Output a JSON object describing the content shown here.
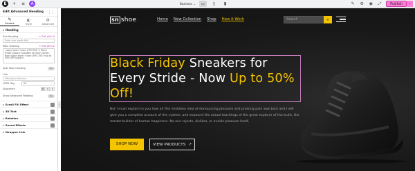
{
  "topbar": {
    "logo_glyph": "E",
    "add_icon": "+",
    "structure_icon": "≡",
    "ai_icon": "A",
    "site_select": "Business",
    "devices": [
      "desktop-icon",
      "tablet-icon",
      "mobile-icon"
    ],
    "right_icons": [
      "ai-magic-icon",
      "settings-icon",
      "preview-icon",
      "history-icon"
    ],
    "publish_label": "Publish",
    "publish_dropdown": "⌄"
  },
  "sidebar": {
    "title": "Edit Advanced Heading",
    "tabs": [
      {
        "icon": "✎",
        "label": "Content",
        "active": true
      },
      {
        "icon": "◐",
        "label": "Style",
        "active": false
      },
      {
        "icon": "⚙",
        "label": "Advanced",
        "active": false
      }
    ],
    "heading_section": "Heading",
    "sub_heading_label": "Sub Heading",
    "sub_heading_ai": "✦ Edit with AI",
    "sub_heading_placeholder": "Enter your prefix title",
    "main_heading_label": "Main Heading",
    "main_heading_ai": "✦ Edit with AI",
    "main_heading_value": "<span style=\"color: #FFC700;\"> Black Friday</span> Sneakers for Every Stride - Now <span style=\"color: #FFC700;\">Up to 50% Off!</span>",
    "split_label": "Split Main Heading",
    "split_toggle": "No",
    "link_label": "Link",
    "link_placeholder": "http://your-link.com",
    "html_tag_label": "HTML Tag",
    "html_tag_value": "H2",
    "alignment_label": "Alignment",
    "show_bg_label": "Show Advanced Heading",
    "show_bg_toggle": "No",
    "collapsed_sections": [
      "Scroll Fill Effect",
      "3D Text",
      "Rotation",
      "Sound Effects",
      "Wrapper Link"
    ]
  },
  "canvas": {
    "logo_box": "sn",
    "logo_text": "shoe",
    "menu": [
      "Home",
      "New Collection",
      "Shop",
      "How it Work"
    ],
    "search_placeholder": "Search",
    "heading_part1": "Black Friday",
    "heading_part2": " Sneakers for Every Stride - Now ",
    "heading_part3": "Up to 50% Off!",
    "paragraph": "But I must explain to you how all this mistaken idea of denouncing pleasure and praising pain was born and I will give you a complete account of the system, and expound the actual teachings of the great explorer of the truth, the master-builder of human happiness. No one rejects, dislikes, or avoids pleasure itself,",
    "btn_shop": "SHOP NOW",
    "btn_view": "VIEW PRODUCTS",
    "btn_view_arrow": "↗",
    "accent_color": "#F5C400"
  }
}
